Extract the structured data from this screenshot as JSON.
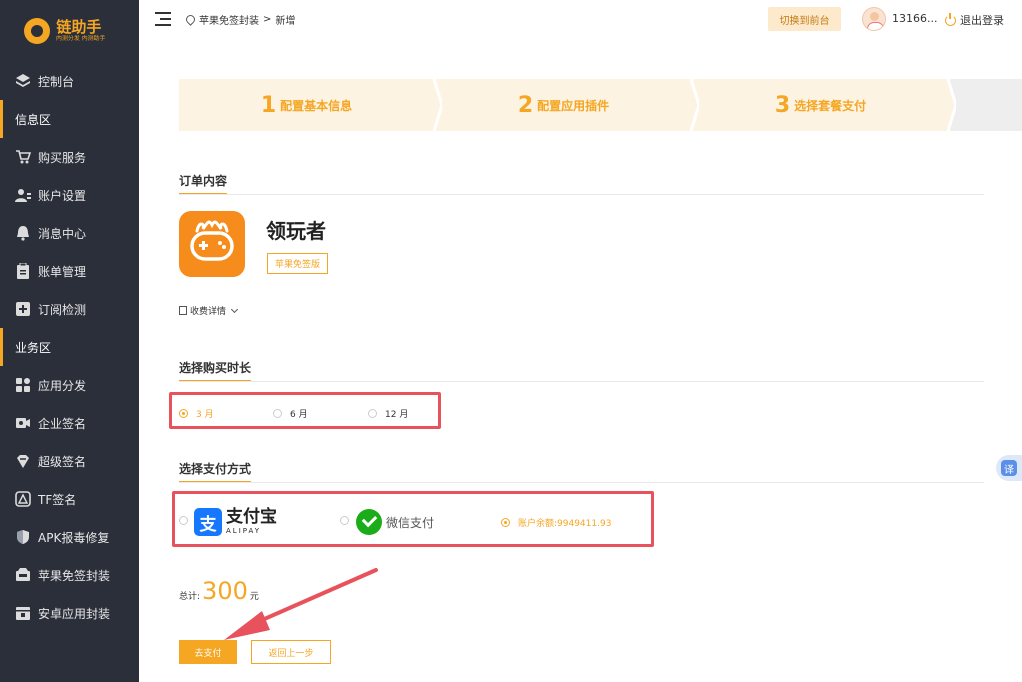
{
  "brand": {
    "name": "链助手",
    "slogan": "内测分发 内测助手",
    "color": "#f5a623"
  },
  "sidebar": {
    "items": [
      {
        "type": "item",
        "label": "控制台",
        "icon": "layers-icon"
      },
      {
        "type": "section",
        "label": "信息区"
      },
      {
        "type": "item",
        "label": "购买服务",
        "icon": "cart-icon"
      },
      {
        "type": "item",
        "label": "账户设置",
        "icon": "user-settings-icon"
      },
      {
        "type": "item",
        "label": "消息中心",
        "icon": "bell-icon"
      },
      {
        "type": "item",
        "label": "账单管理",
        "icon": "clipboard-icon"
      },
      {
        "type": "item",
        "label": "订阅检测",
        "icon": "plus-square-icon"
      },
      {
        "type": "section",
        "label": "业务区"
      },
      {
        "type": "item",
        "label": "应用分发",
        "icon": "grid-icon"
      },
      {
        "type": "item",
        "label": "企业签名",
        "icon": "camera-icon"
      },
      {
        "type": "item",
        "label": "超级签名",
        "icon": "diamond-icon"
      },
      {
        "type": "item",
        "label": "TF签名",
        "icon": "testflight-icon"
      },
      {
        "type": "item",
        "label": "APK报毒修复",
        "icon": "shield-icon"
      },
      {
        "type": "item",
        "label": "苹果免签封装",
        "icon": "package-icon"
      },
      {
        "type": "item",
        "label": "安卓应用封装",
        "icon": "box-icon"
      }
    ]
  },
  "header": {
    "breadcrumb": [
      "苹果免签封装",
      "新增"
    ],
    "breadcrumb_sep": ">",
    "switch_label": "切换到前台",
    "username": "13166...",
    "logout_label": "退出登录"
  },
  "steps": [
    {
      "num": "1",
      "label": "配置基本信息"
    },
    {
      "num": "2",
      "label": "配置应用插件"
    },
    {
      "num": "3",
      "label": "选择套餐支付"
    }
  ],
  "order": {
    "title": "订单内容",
    "app_name": "领玩者",
    "tag": "苹果免签版",
    "fee_detail": "收费详情"
  },
  "duration": {
    "title": "选择购买时长",
    "options": [
      "3 月",
      "6 月",
      "12 月"
    ],
    "selected_index": 0
  },
  "payment": {
    "title": "选择支付方式",
    "alipay_cn": "支付宝",
    "alipay_en": "ALIPAY",
    "wechat_label": "微信支付",
    "balance_label": "账户余额:9949411.93",
    "selected": "balance"
  },
  "total": {
    "prefix": "总计:",
    "amount": "300",
    "unit": "元"
  },
  "actions": {
    "pay_label": "去支付",
    "back_label": "返回上一步"
  },
  "translate_label": "译"
}
